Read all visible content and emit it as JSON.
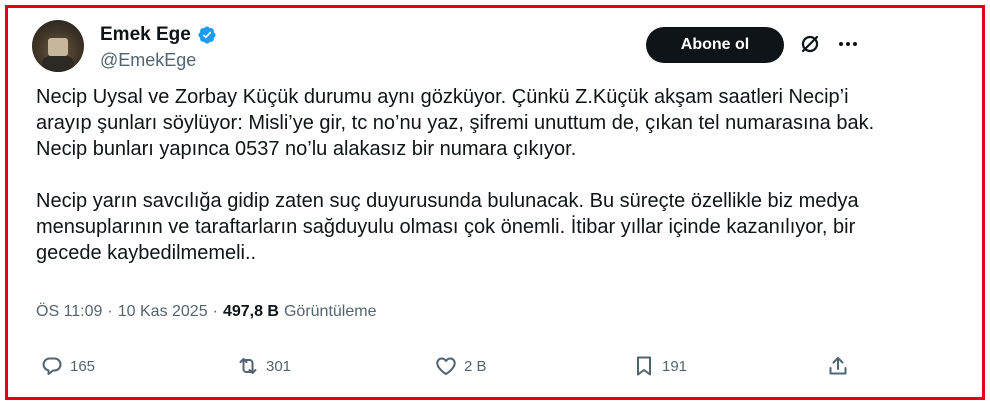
{
  "author": {
    "display_name": "Emek Ege",
    "handle": "@EmekEge",
    "verified_icon": "verified-badge-icon"
  },
  "header": {
    "follow_label": "Abone ol",
    "grok_icon": "grok-icon",
    "more_icon": "more-icon"
  },
  "tweet": {
    "paragraph_1": "Necip Uysal ve Zorbay Küçük durumu aynı gözküyor. Çünkü Z.Küçük akşam saatleri Necip’i arayıp şunları söylüyor: Misli’ye gir, tc no’nu yaz, şifremi unuttum de, çıkan tel numarasına bak. Necip bunları yapınca 0537 no’lu alakasız bir numara çıkıyor.",
    "paragraph_2": "Necip yarın savcılığa gidip zaten suç duyurusunda bulunacak. Bu süreçte özellikle biz medya mensuplarının ve taraftarların sağduyulu olması çok önemli. İtibar yıllar içinde kazanılıyor, bir gecede kaybedilmemeli.."
  },
  "meta": {
    "time": "ÖS 11:09",
    "date": "10 Kas 2025",
    "separator": "·",
    "views_count": "497,8 B",
    "views_label": "Görüntüleme"
  },
  "actions": {
    "replies": "165",
    "reposts": "301",
    "likes": "2 B",
    "bookmarks": "191"
  },
  "colors": {
    "frame_border": "#e3001b",
    "verified": "#1d9bf0",
    "text_primary": "#0f1419",
    "text_secondary": "#536471"
  }
}
